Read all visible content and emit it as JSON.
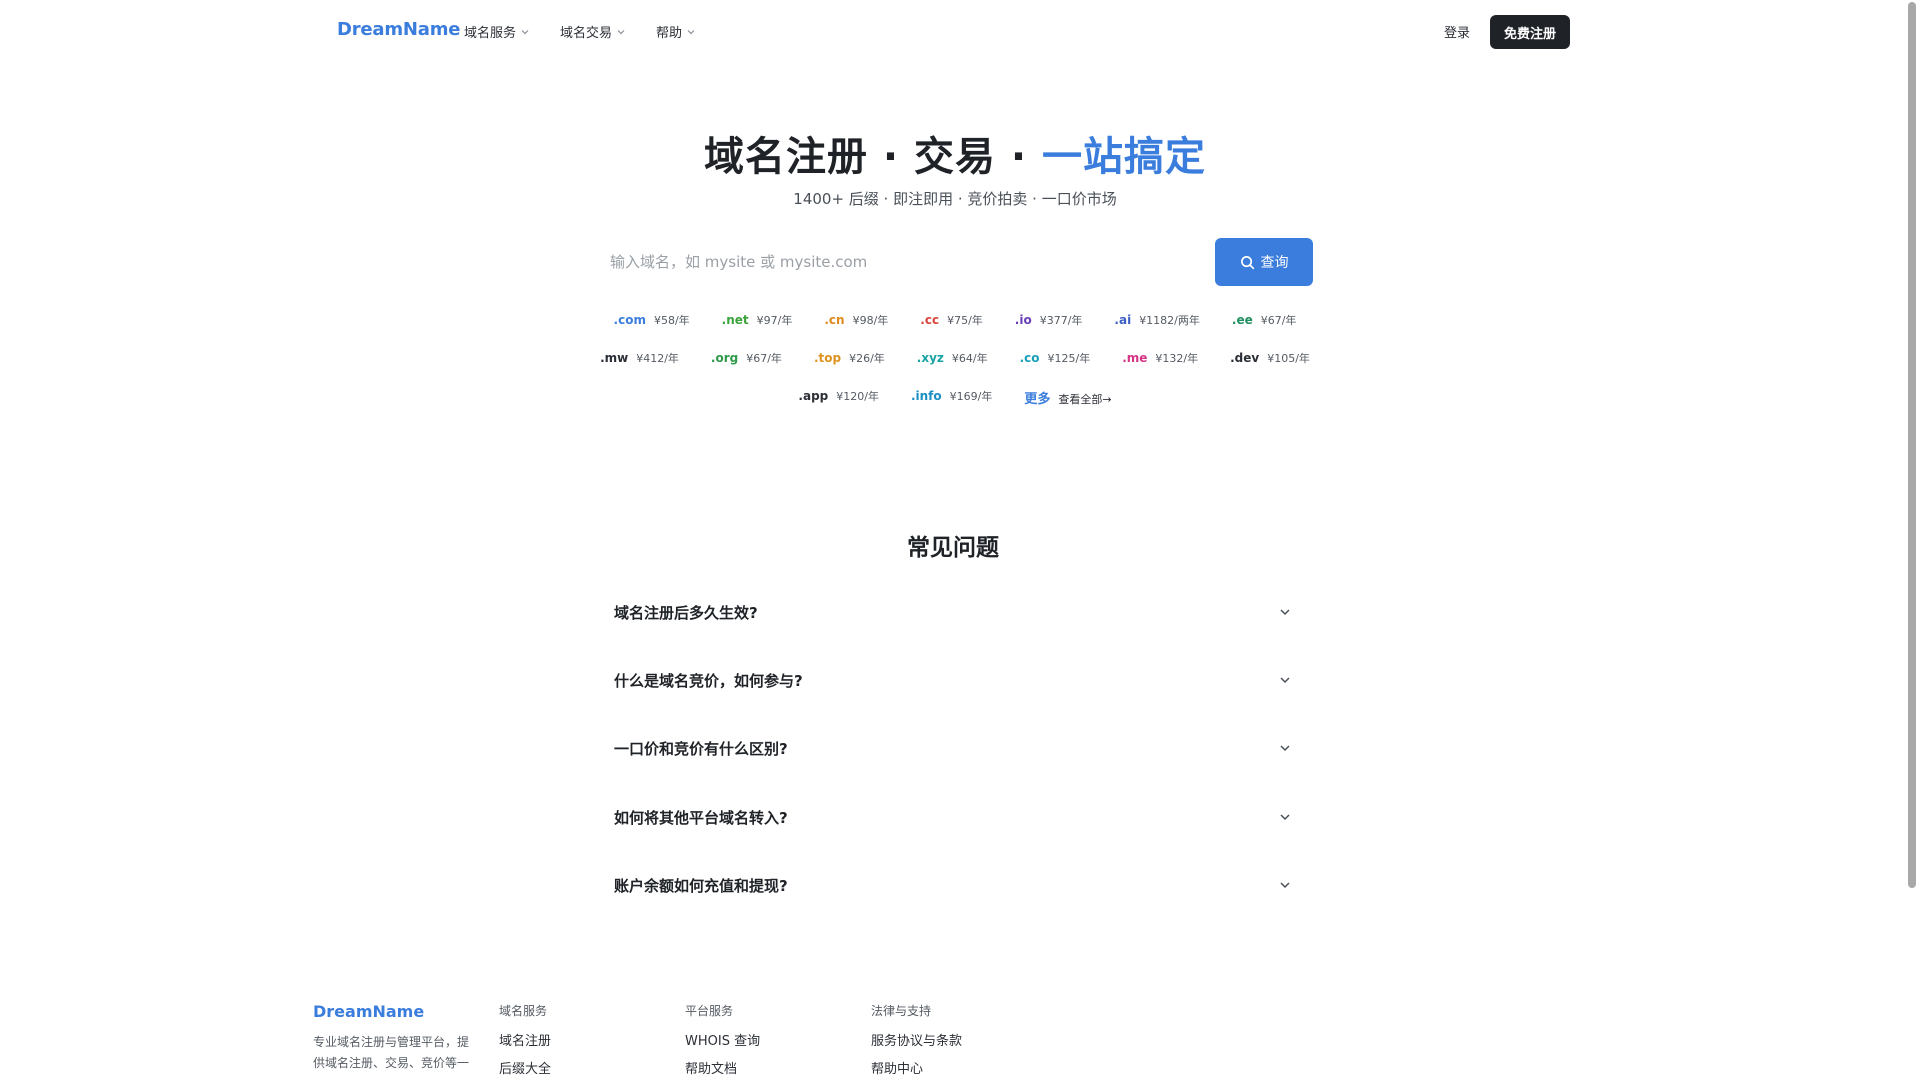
{
  "header": {
    "logo": "DreamName",
    "nav": [
      {
        "label": "域名服务"
      },
      {
        "label": "域名交易"
      },
      {
        "label": "帮助"
      }
    ],
    "login": "登录",
    "register": "免费注册"
  },
  "hero": {
    "title_main": "域名注册 · 交易 · ",
    "title_accent": "一站搞定",
    "subtitle": "1400+ 后缀 · 即注即用 · 竞价拍卖 · 一口价市场",
    "search_placeholder": "输入域名，如 mysite 或 mysite.com",
    "search_button": "查询"
  },
  "tlds": {
    "row1": [
      {
        "ext": ".com",
        "price": "¥58/年",
        "color": "#3b7ddd"
      },
      {
        "ext": ".net",
        "price": "¥97/年",
        "color": "#3aa33a"
      },
      {
        "ext": ".cn",
        "price": "¥98/年",
        "color": "#e08a1e"
      },
      {
        "ext": ".cc",
        "price": "¥75/年",
        "color": "#d9453c"
      },
      {
        "ext": ".io",
        "price": "¥377/年",
        "color": "#6a3fb5"
      },
      {
        "ext": ".ai",
        "price": "¥1182/两年",
        "color": "#3b5fc4"
      },
      {
        "ext": ".ee",
        "price": "¥67/年",
        "color": "#1f8f5f"
      }
    ],
    "row2": [
      {
        "ext": ".mw",
        "price": "¥412/年",
        "color": "#2b2f36"
      },
      {
        "ext": ".org",
        "price": "¥67/年",
        "color": "#2e9a4a"
      },
      {
        "ext": ".top",
        "price": "¥26/年",
        "color": "#e0921e"
      },
      {
        "ext": ".xyz",
        "price": "¥64/年",
        "color": "#1aa3a3"
      },
      {
        "ext": ".co",
        "price": "¥125/年",
        "color": "#17a0b8"
      },
      {
        "ext": ".me",
        "price": "¥132/年",
        "color": "#d63384"
      },
      {
        "ext": ".dev",
        "price": "¥105/年",
        "color": "#2b2f36"
      }
    ],
    "row3": [
      {
        "ext": ".app",
        "price": "¥120/年",
        "color": "#2b2f36"
      },
      {
        "ext": ".info",
        "price": "¥169/年",
        "color": "#1a8fc4"
      }
    ],
    "more_label": "更多",
    "more_link": "查看全部→"
  },
  "faq": {
    "title": "常见问题",
    "items": [
      {
        "q": "域名注册后多久生效?"
      },
      {
        "q": "什么是域名竞价，如何参与?"
      },
      {
        "q": "一口价和竞价有什么区别?"
      },
      {
        "q": "如何将其他平台域名转入?"
      },
      {
        "q": "账户余额如何充值和提现?"
      }
    ]
  },
  "footer": {
    "logo": "DreamName",
    "desc": "专业域名注册与管理平台，提供域名注册、交易、竞价等一",
    "cols": [
      {
        "head": "域名服务",
        "links": [
          "域名注册",
          "后缀大全"
        ]
      },
      {
        "head": "平台服务",
        "links": [
          "WHOIS 查询",
          "帮助文档"
        ]
      },
      {
        "head": "法律与支持",
        "links": [
          "服务协议与条款",
          "帮助中心"
        ]
      }
    ]
  }
}
